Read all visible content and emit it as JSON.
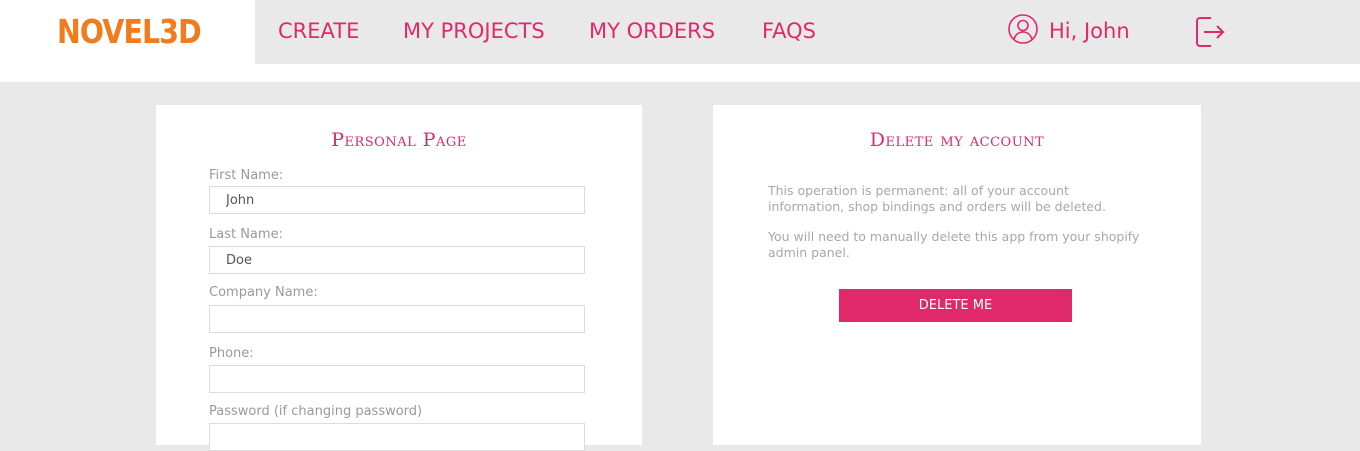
{
  "brand": {
    "logo_text": "NOVEL3D",
    "accent": "#e0296b",
    "logo_color": "#f07c1e"
  },
  "nav": {
    "create": "CREATE",
    "projects": "MY PROJECTS",
    "orders": "MY ORDERS",
    "faqs": "FAQS"
  },
  "user": {
    "greeting": "Hi, John",
    "icon": "user-circle-icon",
    "logout_icon": "logout-icon"
  },
  "personal": {
    "title": "Personal Page",
    "first_name_label": "First Name:",
    "first_name_value": "John",
    "last_name_label": "Last Name:",
    "last_name_value": "Doe",
    "company_label": "Company Name:",
    "company_value": "",
    "phone_label": "Phone:",
    "phone_value": "",
    "password_label": "Password (if changing password)"
  },
  "delete": {
    "title": "Delete my account",
    "desc1": "This operation is permanent: all of your account information, shop bindings and orders will be deleted.",
    "desc2": "You will need to manually delete this app from your shopify admin panel.",
    "button": "DELETE ME"
  }
}
